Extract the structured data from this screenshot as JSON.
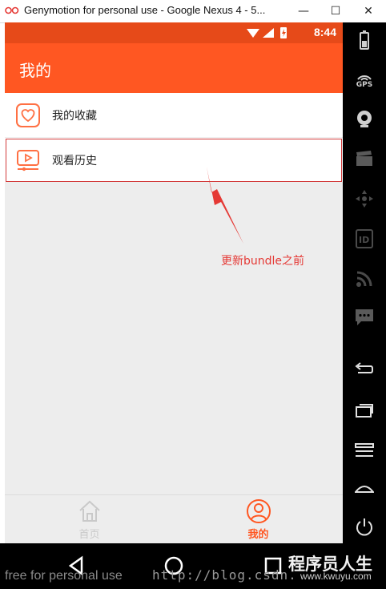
{
  "window": {
    "title": "Genymotion for personal use - Google Nexus 4 - 5...",
    "minimize": "—",
    "maximize": "☐",
    "close": "✕"
  },
  "statusbar": {
    "time": "8:44"
  },
  "app": {
    "title": "我的",
    "menu": [
      {
        "label": "我的收藏",
        "icon": "heart-icon"
      },
      {
        "label": "观看历史",
        "icon": "play-history-icon"
      }
    ]
  },
  "annotation": {
    "text": "更新bundle之前",
    "color": "#e53935"
  },
  "tabs": [
    {
      "label": "首页",
      "icon": "home-icon",
      "active": false
    },
    {
      "label": "我的",
      "icon": "user-icon",
      "active": true
    }
  ],
  "sidebar": {
    "items": [
      {
        "name": "battery-icon"
      },
      {
        "name": "gps-icon",
        "label": "GPS"
      },
      {
        "name": "camera-icon"
      },
      {
        "name": "video-clapper-icon"
      },
      {
        "name": "dpad-icon"
      },
      {
        "name": "id-icon",
        "label": "ID"
      },
      {
        "name": "rss-icon"
      },
      {
        "name": "sms-icon"
      },
      {
        "name": "back-icon"
      },
      {
        "name": "recent-apps-icon"
      },
      {
        "name": "menu-icon"
      },
      {
        "name": "home-icon"
      },
      {
        "name": "power-icon"
      }
    ]
  },
  "watermark": {
    "left": "free for personal use",
    "url": "http://blog.csdn.",
    "brand": "程序员人生",
    "brand_url": "www.kwuyu.com"
  },
  "colors": {
    "accent": "#ff5722",
    "status": "#e64a19",
    "background": "#ededed"
  }
}
